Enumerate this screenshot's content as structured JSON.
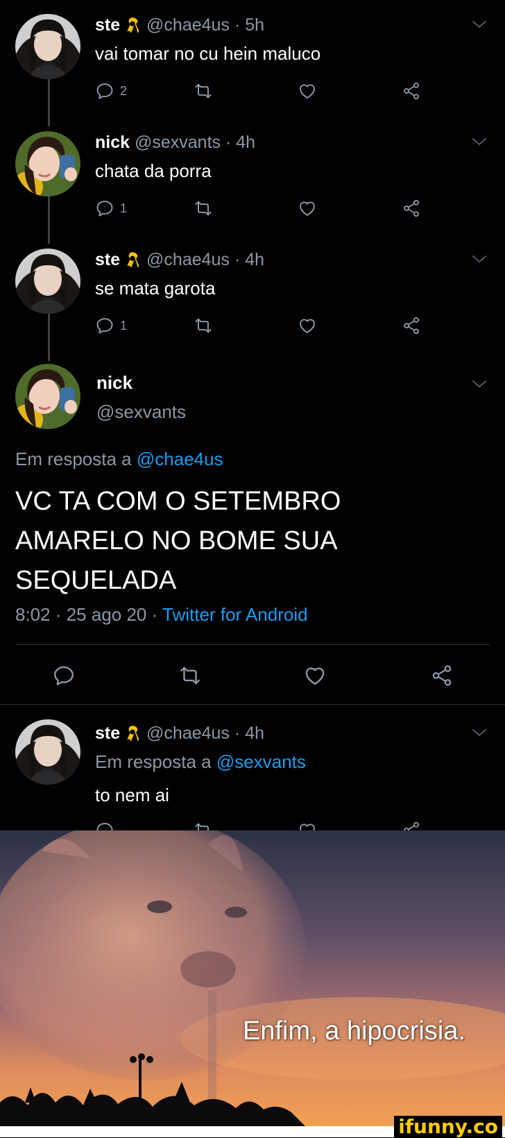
{
  "tweets": [
    {
      "name": "ste",
      "handle": "@chae4us",
      "time": "5h",
      "text": "vai tomar no cu hein maluco",
      "reply_count": "2",
      "badge": "yellow-ribbon"
    },
    {
      "name": "nick",
      "handle": "@sexvants",
      "time": "4h",
      "text": "chata da porra",
      "reply_count": "1"
    },
    {
      "name": "ste",
      "handle": "@chae4us",
      "time": "4h",
      "text": "se mata garota",
      "reply_count": "1",
      "badge": "yellow-ribbon"
    }
  ],
  "main_tweet": {
    "name": "nick",
    "handle": "@sexvants",
    "reply_prefix": "Em resposta a",
    "reply_to": "@chae4us",
    "text_lines": [
      "VC TA COM O SETEMBRO",
      "AMARELO NO BOME SUA",
      "SEQUELADA"
    ],
    "timestamp": "8:02 · 25 ago 20 ·",
    "source": "Twitter for Android"
  },
  "reply_tweet": {
    "name": "ste",
    "handle": "@chae4us",
    "time": "4h",
    "reply_prefix": "Em resposta a",
    "reply_to": "@sexvants",
    "text": "to nem ai"
  },
  "meme": {
    "caption": "Enfim, a hipocrisia."
  },
  "watermark": "ifunny.co",
  "colors": {
    "background": "#000000",
    "muted": "#8b98a5",
    "link": "#1d9bf0",
    "ribbon": "#f5c400"
  }
}
